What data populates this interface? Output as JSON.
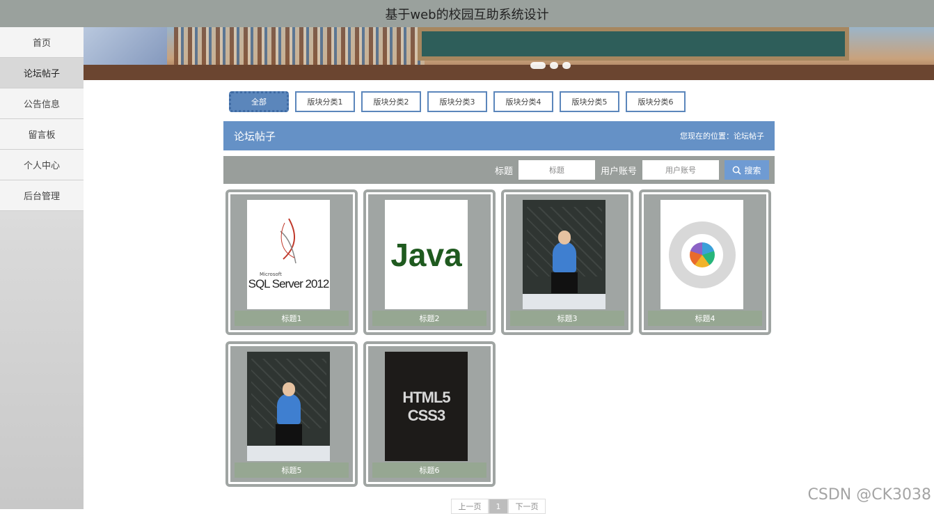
{
  "header": {
    "title": "基于web的校园互助系统设计"
  },
  "sidebar": {
    "items": [
      {
        "label": "首页",
        "active": false
      },
      {
        "label": "论坛帖子",
        "active": true
      },
      {
        "label": "公告信息",
        "active": false
      },
      {
        "label": "留言板",
        "active": false
      },
      {
        "label": "个人中心",
        "active": false
      },
      {
        "label": "后台管理",
        "active": false
      }
    ]
  },
  "categories": [
    "全部",
    "版块分类1",
    "版块分类2",
    "版块分类3",
    "版块分类4",
    "版块分类5",
    "版块分类6"
  ],
  "titlebar": {
    "title": "论坛帖子",
    "location": "您现在的位置：论坛帖子"
  },
  "search": {
    "title_label": "标题",
    "title_placeholder": "标题",
    "account_label": "用户账号",
    "account_placeholder": "用户账号",
    "button_label": "搜索"
  },
  "posts": [
    {
      "caption": "标题1",
      "image_text": "SQL Server 2012",
      "image_sub": "Microsoft"
    },
    {
      "caption": "标题2",
      "image_text": "Java"
    },
    {
      "caption": "标题3"
    },
    {
      "caption": "标题4"
    },
    {
      "caption": "标题5"
    },
    {
      "caption": "标题6",
      "image_text": "HTML5",
      "image_sub": "CSS3"
    }
  ],
  "pagination": {
    "prev": "上一页",
    "current": "1",
    "next": "下一页"
  },
  "watermark": "CSDN @CK3038",
  "colors": {
    "accent": "#6591c6",
    "card_border": "#a0a5a3",
    "caption_bg": "#96a792"
  }
}
